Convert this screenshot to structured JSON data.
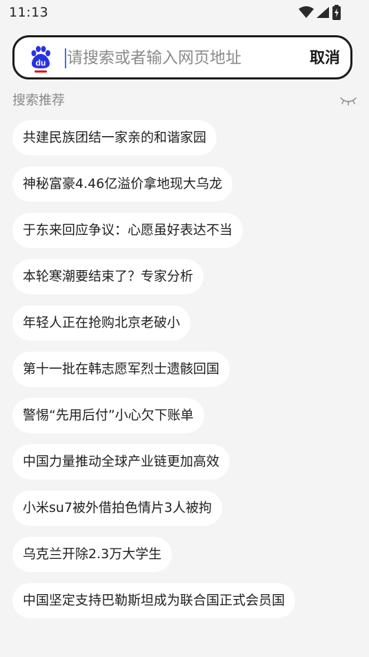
{
  "status_bar": {
    "time": "11:13",
    "icons": [
      "wifi-icon",
      "cellular-signal-icon",
      "battery-charging-icon"
    ]
  },
  "search": {
    "placeholder": "请搜索或者输入网页地址",
    "value": "",
    "cancel_label": "取消",
    "logo": "baidu-logo-icon"
  },
  "recommendations": {
    "title": "搜索推荐",
    "toggle_icon": "eye-closed-icon",
    "items": [
      {
        "text": "共建民族团结一家亲的和谐家园"
      },
      {
        "text": "神秘富豪4.46亿溢价拿地现大乌龙"
      },
      {
        "text": "于东来回应争议：心愿虽好表达不当"
      },
      {
        "text": "本轮寒潮要结束了？专家分析"
      },
      {
        "text": "年轻人正在抢购北京老破小"
      },
      {
        "text": "第十一批在韩志愿军烈士遗骸回国"
      },
      {
        "text": "警惕“先用后付”小心欠下账单"
      },
      {
        "text": "中国力量推动全球产业链更加高效"
      },
      {
        "text": "小米su7被外借拍色情片3人被拘"
      },
      {
        "text": "乌克兰开除2.3万大学生"
      },
      {
        "text": "中国坚定支持巴勒斯坦成为联合国正式会员国"
      }
    ]
  },
  "colors": {
    "background": "#f4f4f4",
    "accent": "#3b6cf6",
    "baidu_blue": "#2932e1",
    "baidu_red": "#e10602",
    "muted_text": "#8a8a8a"
  }
}
